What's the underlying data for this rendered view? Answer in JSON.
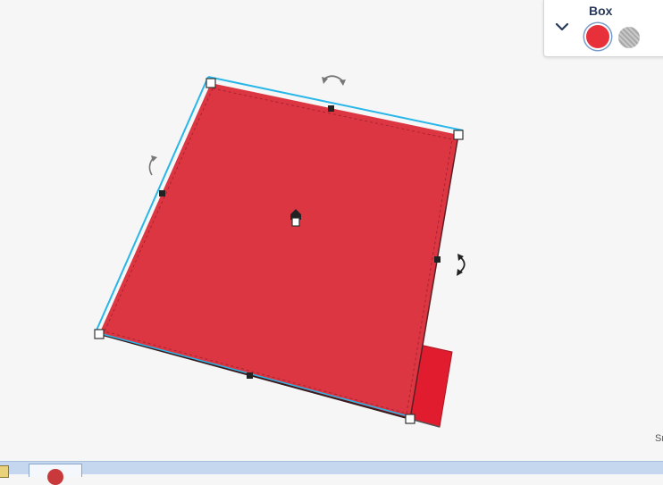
{
  "panel": {
    "title": "Box",
    "solid_color": "#e8303a",
    "hole_pattern": "hatched-gray",
    "collapse_icon": "chevron-down-icon"
  },
  "viewport": {
    "shape": "box",
    "shape_color": "#dc3642",
    "selection_outline_color": "#29b6e8",
    "snap_label": "Sn"
  },
  "taskbar": {
    "color": "#c4d7ee"
  }
}
